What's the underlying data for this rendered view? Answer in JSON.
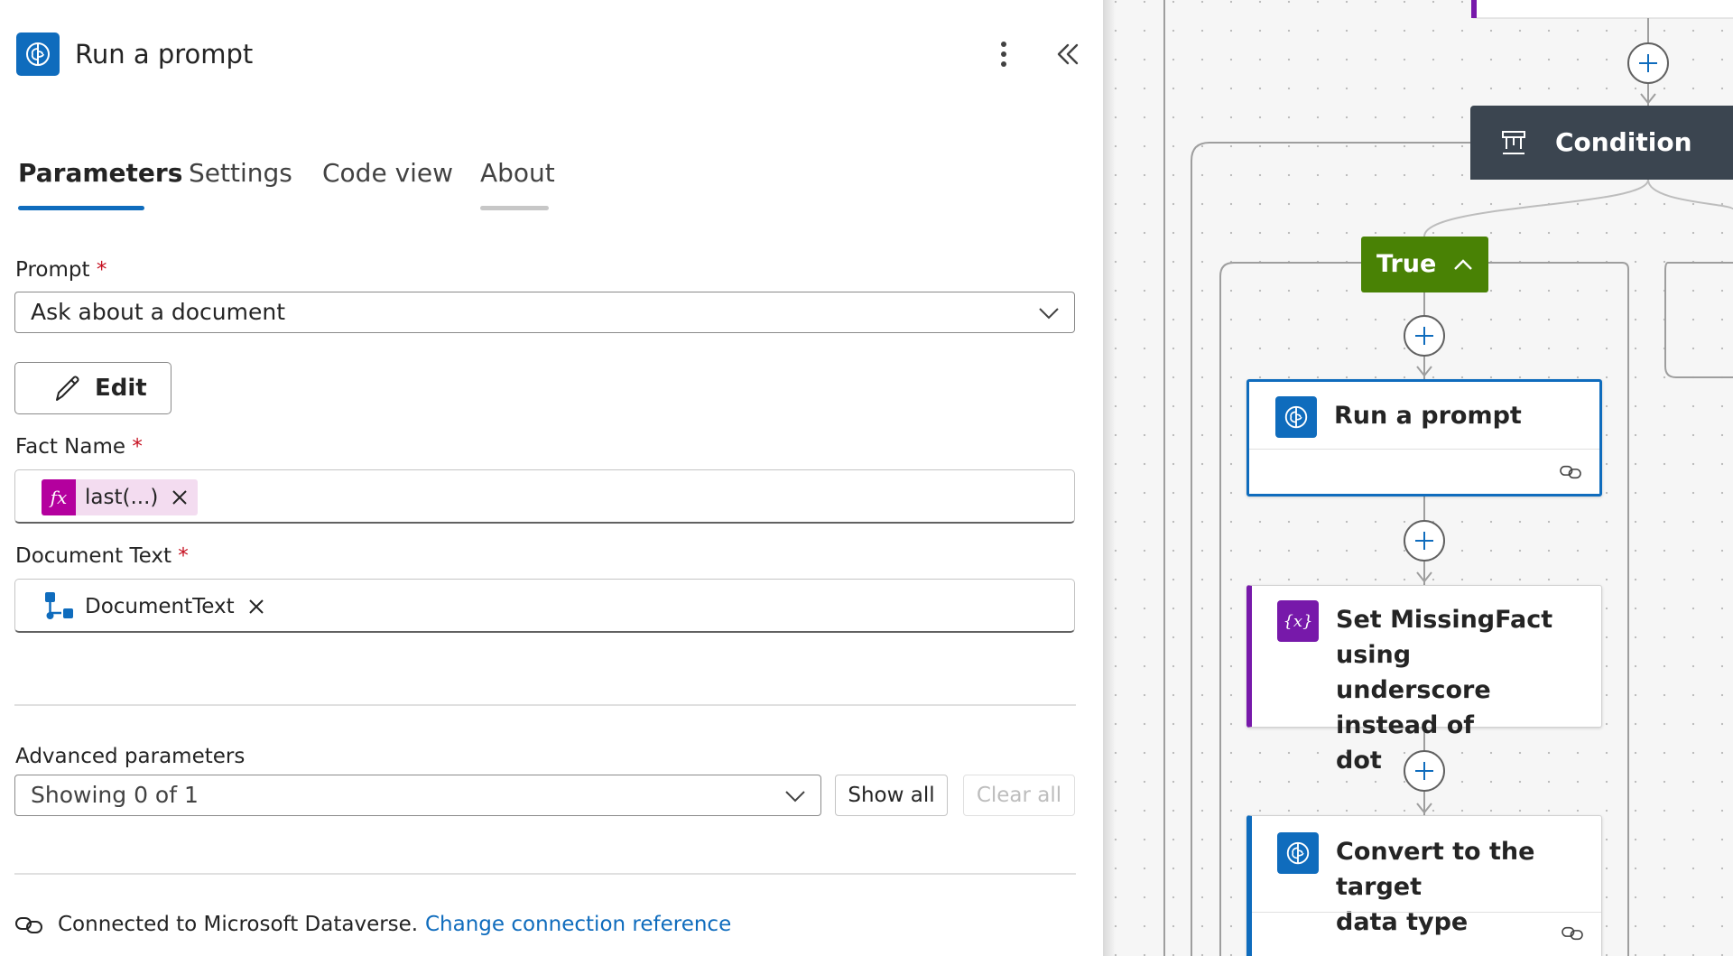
{
  "panel": {
    "title": "Run a prompt",
    "tabs": [
      {
        "label": "Parameters",
        "active": true
      },
      {
        "label": "Settings",
        "active": false
      },
      {
        "label": "Code view",
        "active": false
      },
      {
        "label": "About",
        "active": false
      }
    ],
    "prompt": {
      "label": "Prompt",
      "required_mark": "*",
      "value": "Ask about a document"
    },
    "edit_label": "Edit",
    "fact_name": {
      "label": "Fact Name",
      "required_mark": "*",
      "token": "last(...)"
    },
    "document_text": {
      "label": "Document Text",
      "required_mark": "*",
      "token": "DocumentText"
    },
    "advanced": {
      "label": "Advanced parameters",
      "value": "Showing 0 of 1",
      "show_all": "Show all",
      "clear_all": "Clear all"
    },
    "connection": {
      "text": "Connected to Microsoft Dataverse.",
      "link": "Change connection reference"
    }
  },
  "canvas": {
    "condition_label": "Condition",
    "true_label": "True",
    "cards": [
      {
        "title_lines": [
          "Run a prompt"
        ],
        "icon": "ai-brain-icon"
      },
      {
        "title_lines": [
          "Set MissingFact using",
          "underscore instead of",
          "dot"
        ],
        "icon": "variable-icon"
      },
      {
        "title_lines": [
          "Convert to the target",
          "data type"
        ],
        "icon": "ai-brain-icon"
      }
    ]
  },
  "colors": {
    "accent": "#0f6cbd",
    "expression": "#b4009e",
    "variable": "#7719aa",
    "condition": "#3b4550",
    "true_branch": "#498205",
    "link": "#0f6cbd",
    "required": "#c50f1f"
  }
}
